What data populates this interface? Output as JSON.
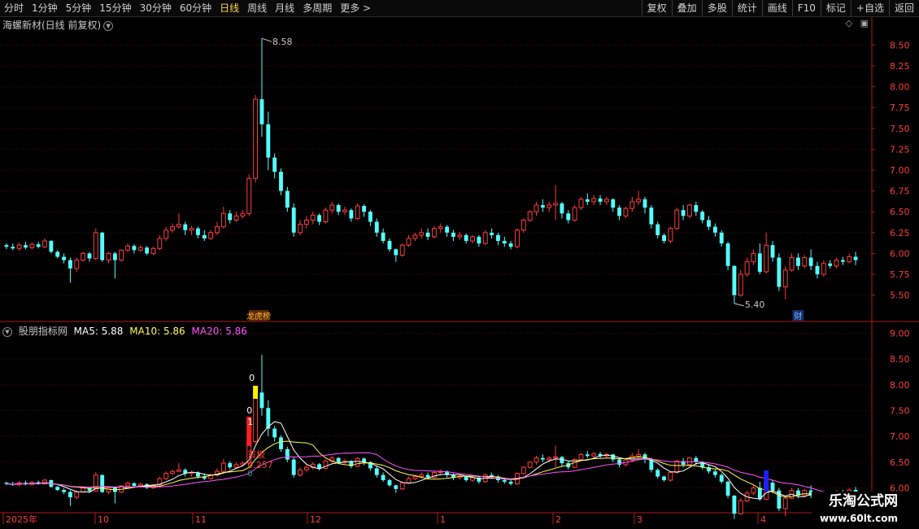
{
  "toolbar": {
    "periods": [
      "分时",
      "1分钟",
      "5分钟",
      "15分钟",
      "30分钟",
      "60分钟",
      "日线",
      "周线",
      "月线",
      "多周期",
      "更多 >"
    ],
    "active_index": 6,
    "right_buttons": [
      "复权",
      "叠加",
      "多股",
      "统计",
      "画线",
      "F10",
      "标记",
      "+自选",
      "返回"
    ]
  },
  "main_chart": {
    "title": "海螺新材(日线 前复权)",
    "high_label": "8.58",
    "low_label": "5.40",
    "event_tag_1": "龙虎榜",
    "event_tag_2": "财",
    "y_ticks": [
      "8.50",
      "8.25",
      "8.00",
      "7.75",
      "7.50",
      "7.25",
      "7.00",
      "6.75",
      "6.50",
      "6.25",
      "6.00",
      "5.75",
      "5.50"
    ]
  },
  "indicator": {
    "name": "股朋指标网",
    "ma5_label": "MA5: 5.88",
    "ma10_label": "MA10: 5.86",
    "ma20_label": "MA20: 5.86",
    "annotations": {
      "top_zero": "0",
      "mid_zero": "0",
      "one": "1",
      "board_text": "首板",
      "value_text": "0.257",
      "bottom_zero": "0"
    },
    "y_ticks": [
      "9.00",
      "8.50",
      "8.00",
      "7.50",
      "7.00",
      "6.50",
      "6.00"
    ]
  },
  "time_axis": {
    "labels": [
      "2025年",
      "10",
      "11",
      "12",
      "1",
      "2",
      "3",
      "4"
    ]
  },
  "watermark": {
    "line1": "乐淘公式网",
    "line2": "www.60lt.com"
  },
  "colors": {
    "up": "#ff3c3c",
    "down": "#54ffff",
    "ma5": "#ffffff",
    "ma10": "#ffff54",
    "ma20": "#ff54ff",
    "axis": "#b01818",
    "grid": "#5a0a0a"
  },
  "chart_data": {
    "type": "candlestick",
    "ylim": [
      5.35,
      8.65
    ],
    "candles": [
      [
        6.1,
        6.12,
        6.08,
        6.05
      ],
      [
        6.08,
        6.12,
        6.06,
        6.04
      ],
      [
        6.06,
        6.13,
        6.1,
        6.03
      ],
      [
        6.1,
        6.14,
        6.07,
        6.05
      ],
      [
        6.07,
        6.13,
        6.11,
        6.05
      ],
      [
        6.11,
        6.14,
        6.08,
        6.06
      ],
      [
        6.08,
        6.18,
        6.15,
        6.06
      ],
      [
        6.15,
        6.16,
        6.02,
        6.0
      ],
      [
        6.02,
        6.04,
        5.96,
        5.94
      ],
      [
        5.96,
        6.0,
        5.92,
        5.88
      ],
      [
        5.92,
        5.95,
        5.82,
        5.65
      ],
      [
        5.82,
        5.95,
        5.92,
        5.78
      ],
      [
        5.92,
        6.02,
        6.0,
        5.9
      ],
      [
        6.0,
        6.02,
        5.94,
        5.9
      ],
      [
        5.94,
        6.3,
        6.25,
        5.92
      ],
      [
        6.25,
        6.26,
        5.92,
        5.9
      ],
      [
        5.92,
        6.02,
        6.0,
        5.88
      ],
      [
        6.0,
        6.02,
        5.92,
        5.7
      ],
      [
        5.92,
        6.05,
        6.04,
        5.9
      ],
      [
        6.04,
        6.12,
        6.09,
        6.02
      ],
      [
        6.09,
        6.11,
        6.04,
        6.0
      ],
      [
        6.04,
        6.1,
        6.07,
        6.02
      ],
      [
        6.07,
        6.09,
        6.0,
        5.98
      ],
      [
        6.0,
        6.08,
        6.06,
        5.98
      ],
      [
        6.06,
        6.22,
        6.18,
        6.04
      ],
      [
        6.18,
        6.32,
        6.28,
        6.15
      ],
      [
        6.28,
        6.36,
        6.32,
        6.25
      ],
      [
        6.32,
        6.48,
        6.35,
        6.3
      ],
      [
        6.35,
        6.38,
        6.28,
        6.22
      ],
      [
        6.28,
        6.33,
        6.3,
        6.22
      ],
      [
        6.3,
        6.32,
        6.22,
        6.18
      ],
      [
        6.22,
        6.28,
        6.18,
        6.15
      ],
      [
        6.18,
        6.28,
        6.25,
        6.16
      ],
      [
        6.25,
        6.38,
        6.32,
        6.22
      ],
      [
        6.32,
        6.56,
        6.48,
        6.3
      ],
      [
        6.48,
        6.52,
        6.4,
        6.36
      ],
      [
        6.4,
        6.5,
        6.45,
        6.38
      ],
      [
        6.45,
        6.52,
        6.48,
        6.42
      ],
      [
        6.48,
        6.95,
        6.9,
        6.45
      ],
      [
        6.9,
        7.9,
        7.85,
        6.85
      ],
      [
        7.85,
        8.58,
        7.55,
        7.4
      ],
      [
        7.55,
        7.7,
        7.15,
        7.0
      ],
      [
        7.15,
        7.2,
        6.98,
        6.9
      ],
      [
        6.98,
        7.02,
        6.75,
        6.7
      ],
      [
        6.75,
        6.8,
        6.55,
        6.5
      ],
      [
        6.55,
        6.6,
        6.25,
        6.2
      ],
      [
        6.25,
        6.4,
        6.35,
        6.22
      ],
      [
        6.35,
        6.45,
        6.4,
        6.3
      ],
      [
        6.4,
        6.5,
        6.46,
        6.35
      ],
      [
        6.46,
        6.48,
        6.38,
        6.34
      ],
      [
        6.38,
        6.55,
        6.52,
        6.36
      ],
      [
        6.52,
        6.62,
        6.58,
        6.48
      ],
      [
        6.58,
        6.6,
        6.5,
        6.46
      ],
      [
        6.5,
        6.56,
        6.52,
        6.46
      ],
      [
        6.52,
        6.54,
        6.42,
        6.38
      ],
      [
        6.42,
        6.6,
        6.57,
        6.4
      ],
      [
        6.57,
        6.59,
        6.5,
        6.44
      ],
      [
        6.5,
        6.52,
        6.38,
        6.33
      ],
      [
        6.38,
        6.42,
        6.25,
        6.2
      ],
      [
        6.25,
        6.3,
        6.15,
        6.12
      ],
      [
        6.15,
        6.18,
        6.05,
        6.02
      ],
      [
        6.05,
        6.06,
        5.98,
        5.9
      ],
      [
        5.98,
        6.12,
        6.1,
        5.96
      ],
      [
        6.1,
        6.22,
        6.18,
        6.08
      ],
      [
        6.18,
        6.25,
        6.22,
        6.15
      ],
      [
        6.22,
        6.3,
        6.25,
        6.18
      ],
      [
        6.25,
        6.3,
        6.2,
        6.16
      ],
      [
        6.2,
        6.33,
        6.3,
        6.18
      ],
      [
        6.3,
        6.36,
        6.32,
        6.25
      ],
      [
        6.32,
        6.34,
        6.25,
        6.2
      ],
      [
        6.25,
        6.28,
        6.2,
        6.15
      ],
      [
        6.2,
        6.26,
        6.22,
        6.16
      ],
      [
        6.22,
        6.24,
        6.15,
        6.12
      ],
      [
        6.15,
        6.22,
        6.2,
        6.12
      ],
      [
        6.2,
        6.22,
        6.12,
        6.08
      ],
      [
        6.12,
        6.28,
        6.25,
        6.1
      ],
      [
        6.25,
        6.3,
        6.22,
        6.18
      ],
      [
        6.22,
        6.25,
        6.15,
        6.1
      ],
      [
        6.15,
        6.2,
        6.12,
        6.08
      ],
      [
        6.12,
        6.15,
        6.08,
        6.05
      ],
      [
        6.08,
        6.3,
        6.28,
        6.06
      ],
      [
        6.28,
        6.42,
        6.4,
        6.25
      ],
      [
        6.4,
        6.52,
        6.5,
        6.38
      ],
      [
        6.5,
        6.62,
        6.58,
        6.45
      ],
      [
        6.58,
        6.65,
        6.55,
        6.5
      ],
      [
        6.55,
        6.62,
        6.58,
        6.5
      ],
      [
        6.58,
        6.82,
        6.6,
        6.4
      ],
      [
        6.6,
        6.62,
        6.48,
        6.42
      ],
      [
        6.48,
        6.52,
        6.4,
        6.36
      ],
      [
        6.4,
        6.58,
        6.55,
        6.38
      ],
      [
        6.55,
        6.68,
        6.65,
        6.52
      ],
      [
        6.65,
        6.72,
        6.62,
        6.58
      ],
      [
        6.62,
        6.7,
        6.66,
        6.58
      ],
      [
        6.66,
        6.7,
        6.62,
        6.58
      ],
      [
        6.62,
        6.68,
        6.65,
        6.58
      ],
      [
        6.65,
        6.66,
        6.55,
        6.5
      ],
      [
        6.55,
        6.58,
        6.45,
        6.4
      ],
      [
        6.45,
        6.56,
        6.54,
        6.42
      ],
      [
        6.54,
        6.68,
        6.62,
        6.5
      ],
      [
        6.62,
        6.75,
        6.65,
        6.58
      ],
      [
        6.65,
        6.68,
        6.55,
        6.48
      ],
      [
        6.55,
        6.58,
        6.35,
        6.3
      ],
      [
        6.35,
        6.38,
        6.22,
        6.18
      ],
      [
        6.22,
        6.24,
        6.15,
        6.12
      ],
      [
        6.15,
        6.32,
        6.3,
        6.12
      ],
      [
        6.3,
        6.55,
        6.52,
        6.28
      ],
      [
        6.52,
        6.58,
        6.45,
        6.4
      ],
      [
        6.45,
        6.6,
        6.58,
        6.42
      ],
      [
        6.58,
        6.62,
        6.5,
        6.45
      ],
      [
        6.5,
        6.52,
        6.4,
        6.36
      ],
      [
        6.4,
        6.45,
        6.32,
        6.28
      ],
      [
        6.32,
        6.36,
        6.25,
        6.2
      ],
      [
        6.25,
        6.28,
        6.12,
        6.08
      ],
      [
        6.12,
        6.14,
        5.85,
        5.8
      ],
      [
        5.85,
        5.86,
        5.5,
        5.4
      ],
      [
        5.5,
        5.8,
        5.75,
        5.48
      ],
      [
        5.75,
        5.95,
        5.9,
        5.72
      ],
      [
        5.9,
        6.05,
        6.0,
        5.86
      ],
      [
        6.0,
        6.12,
        5.78,
        5.75
      ],
      [
        5.78,
        6.25,
        6.1,
        5.76
      ],
      [
        6.1,
        6.15,
        5.95,
        5.9
      ],
      [
        5.95,
        6.0,
        5.6,
        5.55
      ],
      [
        5.6,
        5.85,
        5.8,
        5.45
      ],
      [
        5.8,
        6.0,
        5.95,
        5.78
      ],
      [
        5.95,
        6.0,
        5.85,
        5.8
      ],
      [
        5.85,
        5.98,
        5.95,
        5.82
      ],
      [
        5.95,
        6.05,
        5.85,
        5.8
      ],
      [
        5.85,
        5.9,
        5.75,
        5.7
      ],
      [
        5.75,
        5.92,
        5.88,
        5.72
      ],
      [
        5.88,
        5.92,
        5.85,
        5.82
      ],
      [
        5.85,
        5.95,
        5.92,
        5.82
      ],
      [
        5.92,
        5.96,
        5.9,
        5.86
      ],
      [
        5.9,
        6.0,
        5.96,
        5.88
      ],
      [
        5.96,
        6.02,
        5.92,
        5.86
      ]
    ]
  }
}
